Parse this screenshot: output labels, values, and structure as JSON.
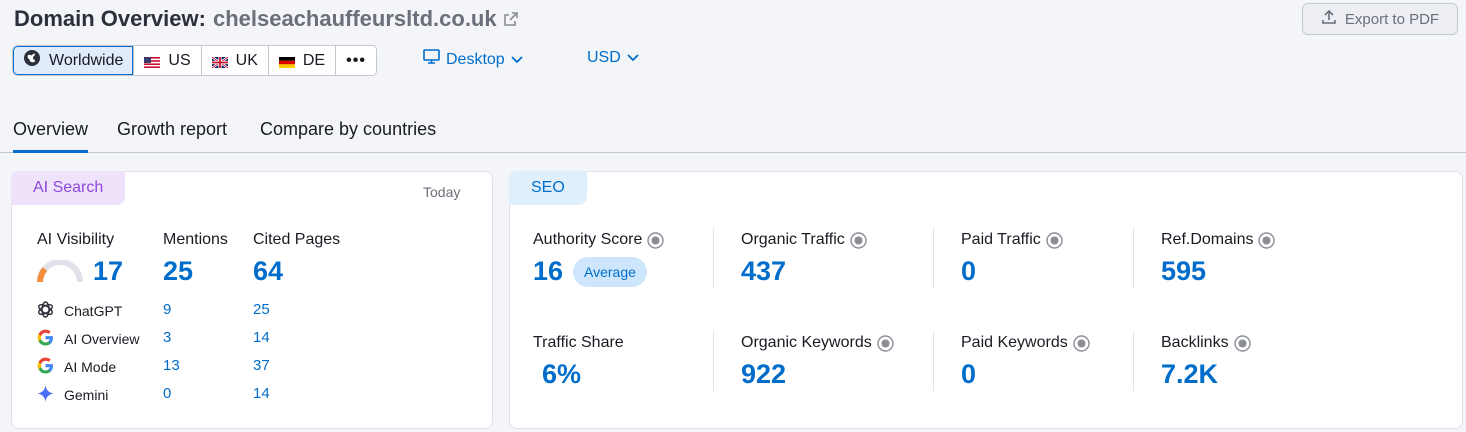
{
  "header": {
    "title": "Domain Overview:",
    "domain": "chelseachauffeursltd.co.uk",
    "export_label": "Export to PDF"
  },
  "databases": {
    "items": [
      {
        "label": "Worldwide",
        "icon": "globe-icon",
        "active": true
      },
      {
        "label": "US",
        "icon": "flag-us-icon"
      },
      {
        "label": "UK",
        "icon": "flag-uk-icon"
      },
      {
        "label": "DE",
        "icon": "flag-de-icon"
      }
    ],
    "more_label": "•••"
  },
  "device": {
    "label": "Desktop"
  },
  "currency": {
    "label": "USD"
  },
  "tabs": [
    {
      "label": "Overview",
      "active": true
    },
    {
      "label": "Growth report"
    },
    {
      "label": "Compare by countries"
    }
  ],
  "ai_search": {
    "tag": "AI Search",
    "date": "Today",
    "visibility_label": "AI Visibility",
    "visibility_value": "17",
    "mentions_label": "Mentions",
    "mentions_value": "25",
    "cited_label": "Cited Pages",
    "cited_value": "64",
    "rows": [
      {
        "label": "ChatGPT",
        "mentions": "9",
        "cited": "25"
      },
      {
        "label": "AI Overview",
        "mentions": "3",
        "cited": "14"
      },
      {
        "label": "AI Mode",
        "mentions": "13",
        "cited": "37"
      },
      {
        "label": "Gemini",
        "mentions": "0",
        "cited": "14"
      }
    ]
  },
  "seo": {
    "tag": "SEO",
    "authority_label": "Authority Score",
    "authority_value": "16",
    "authority_badge": "Average",
    "organic_traffic_label": "Organic Traffic",
    "organic_traffic_value": "437",
    "paid_traffic_label": "Paid Traffic",
    "paid_traffic_value": "0",
    "ref_domains_label": "Ref.Domains",
    "ref_domains_value": "595",
    "traffic_share_label": "Traffic Share",
    "traffic_share_value": "6%",
    "organic_keywords_label": "Organic Keywords",
    "organic_keywords_value": "922",
    "paid_keywords_label": "Paid Keywords",
    "paid_keywords_value": "0",
    "backlinks_label": "Backlinks",
    "backlinks_value": "7.2K"
  },
  "colors": {
    "accent": "#006dca",
    "ai_tag_bg": "#efe3fb",
    "ai_tag_text": "#8f49d9",
    "seo_tag_bg": "#dff0fc",
    "seo_tag_text": "#006dca"
  }
}
